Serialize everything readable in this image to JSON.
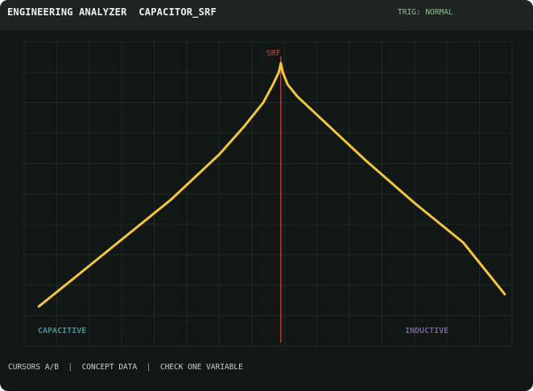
{
  "header": {
    "app_name": "ENGINEERING ANALYZER",
    "file_name": "CAPACITOR_SRF",
    "trigger_status": "TRIG: NORMAL"
  },
  "plot": {
    "marker_label": "SRF",
    "left_region_label": "CAPACITIVE",
    "right_region_label": "INDUCTIVE",
    "colors": {
      "curve": "#f2c53d",
      "marker": "#c44a45",
      "capacitive": "#4a8c98",
      "inductive": "#7b5f97",
      "grid": "#222a26"
    }
  },
  "chart_data": {
    "type": "line",
    "title": "",
    "xlabel": "",
    "ylabel": "",
    "xlim": [
      0,
      1
    ],
    "ylim": [
      0,
      1
    ],
    "grid": true,
    "x_grid_lines": 15,
    "y_grid_lines": 10,
    "marker_x": 0.526,
    "series": [
      {
        "values_x": [
          0.03,
          0.1,
          0.2,
          0.3,
          0.4,
          0.45,
          0.49,
          0.51,
          0.522,
          0.526,
          0.53,
          0.54,
          0.56,
          0.6,
          0.7,
          0.8,
          0.9,
          0.985
        ],
        "values_y": [
          0.13,
          0.22,
          0.35,
          0.48,
          0.63,
          0.72,
          0.8,
          0.86,
          0.9,
          0.93,
          0.9,
          0.86,
          0.82,
          0.76,
          0.61,
          0.47,
          0.34,
          0.17
        ]
      }
    ]
  },
  "footer": {
    "item1": "CURSORS A/B",
    "sep1": "|",
    "item2": "CONCEPT DATA",
    "sep2": "|",
    "item3": "CHECK ONE VARIABLE"
  }
}
